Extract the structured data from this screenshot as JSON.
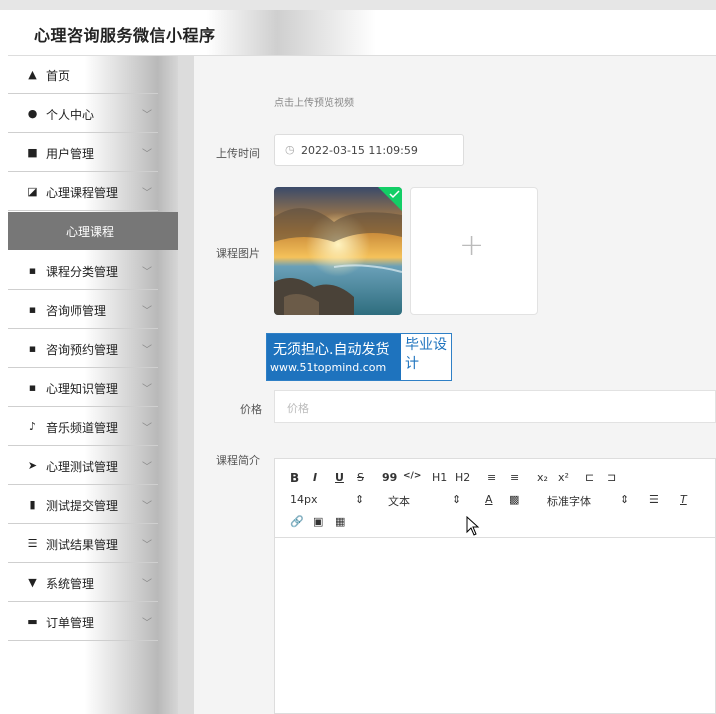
{
  "app": {
    "title": "心理咨询服务微信小程序"
  },
  "sidebar": {
    "items": [
      {
        "label": "首页",
        "icon": "home-icon",
        "chev": ""
      },
      {
        "label": "个人中心",
        "icon": "user-icon",
        "chev": "﹀"
      },
      {
        "label": "用户管理",
        "icon": "users-icon",
        "chev": "﹀"
      },
      {
        "label": "心理课程管理",
        "icon": "chart-icon",
        "chev": "﹀"
      },
      {
        "label": "课程分类管理",
        "icon": "grid-icon",
        "chev": "﹀"
      },
      {
        "label": "咨询师管理",
        "icon": "grid-icon",
        "chev": "﹀"
      },
      {
        "label": "咨询预约管理",
        "icon": "grid-icon",
        "chev": "﹀"
      },
      {
        "label": "心理知识管理",
        "icon": "grid-icon",
        "chev": "﹀"
      },
      {
        "label": "音乐频道管理",
        "icon": "music-icon",
        "chev": "﹀"
      },
      {
        "label": "心理测试管理",
        "icon": "send-icon",
        "chev": "﹀"
      },
      {
        "label": "测试提交管理",
        "icon": "bars-icon",
        "chev": "﹀"
      },
      {
        "label": "测试结果管理",
        "icon": "sliders-icon",
        "chev": "﹀"
      },
      {
        "label": "系统管理",
        "icon": "filter-icon",
        "chev": "﹀"
      },
      {
        "label": "订单管理",
        "icon": "cart-icon",
        "chev": "﹀"
      }
    ],
    "active_submenu": "心理课程"
  },
  "form": {
    "video_hint": "点击上传预览视频",
    "upload_time_label": "上传时间",
    "upload_time_value": "2022-03-15 11:09:59",
    "image_label": "课程图片",
    "price_label": "价格",
    "price_placeholder": "价格",
    "intro_label": "课程简介"
  },
  "watermark": {
    "line1": "无须担心.自动发货",
    "line2": "www.51topmind.com",
    "right": "毕业设计"
  },
  "editor": {
    "toolbar_row1": [
      "B",
      "I",
      "U",
      "S",
      "99",
      "</>",
      "H1",
      "H2",
      "≡",
      "≡",
      "x₂",
      "x²",
      "⊏",
      "⊐"
    ],
    "font_size": "14px",
    "text_style": "文本",
    "font_family": "标准字体",
    "toolbar_row3": [
      "🔗",
      "▣",
      "▦"
    ]
  },
  "colors": {
    "accent": "#1e73be",
    "active_menu": "#777777"
  }
}
